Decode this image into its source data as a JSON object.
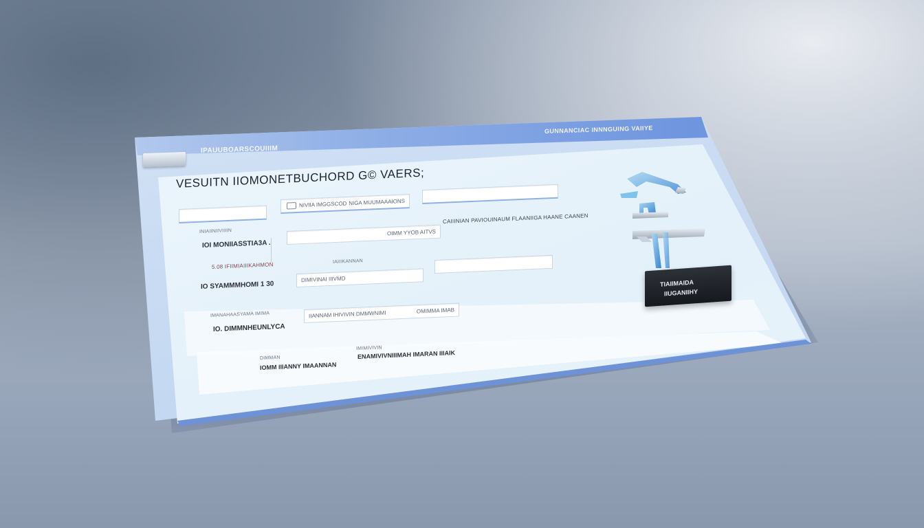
{
  "window": {
    "header_left": "IPAUUBOARSCOUIIIM",
    "header_right": "GUNNANCIAC INNNGUING VAIIYE",
    "title": "VESUITN IIOMONETBUCHORD G© VAERS;"
  },
  "form": {
    "top_row": {
      "field1_value": "",
      "field2_value": "NIVIIA IMGGSCOD",
      "field2_value_right": "NIGA MUUMAAAIONS",
      "field3_value": ""
    },
    "section_label": "CAIIINIAN PAVIOUINAUM FLAANIIGA HAANE CAANEN",
    "rows": [
      {
        "small": "INIAIINIIVIIIIN",
        "label": "IOI MONIIASSTIA3A .",
        "value": "OIMM YYOB AITVS"
      },
      {
        "small": "5.08 IFIIMIAIIIKAHMON",
        "label": "",
        "value": ""
      },
      {
        "small": "IAIIIKANNAN",
        "label": "IO SYAMMMHOMI 1 30",
        "value": "DIMIVINAI IIIVMD"
      },
      {
        "small": "IMANAHAASYAMA IMIMA",
        "label": "IO. DIMMNHEUNLYCA",
        "value": "IIANNAM IHIVIVIN DMMWNIMI",
        "value_right": "OMIMMA IMAB"
      }
    ],
    "footer": {
      "small_left": "DIMMAN",
      "label_left": "IOMM IIIANNY IMAANNAN",
      "small_right": "IMIMIVIVIN",
      "label_right": "ENAMIVIVNIIIMAH IMARAN IIIAIK"
    }
  },
  "badge": {
    "line1": "TIAIIMAIDA",
    "line2": "IIUGANIIHY"
  },
  "colors": {
    "accent": "#6f95df",
    "panel": "#eaf4fb",
    "badge": "#1c1f24"
  }
}
